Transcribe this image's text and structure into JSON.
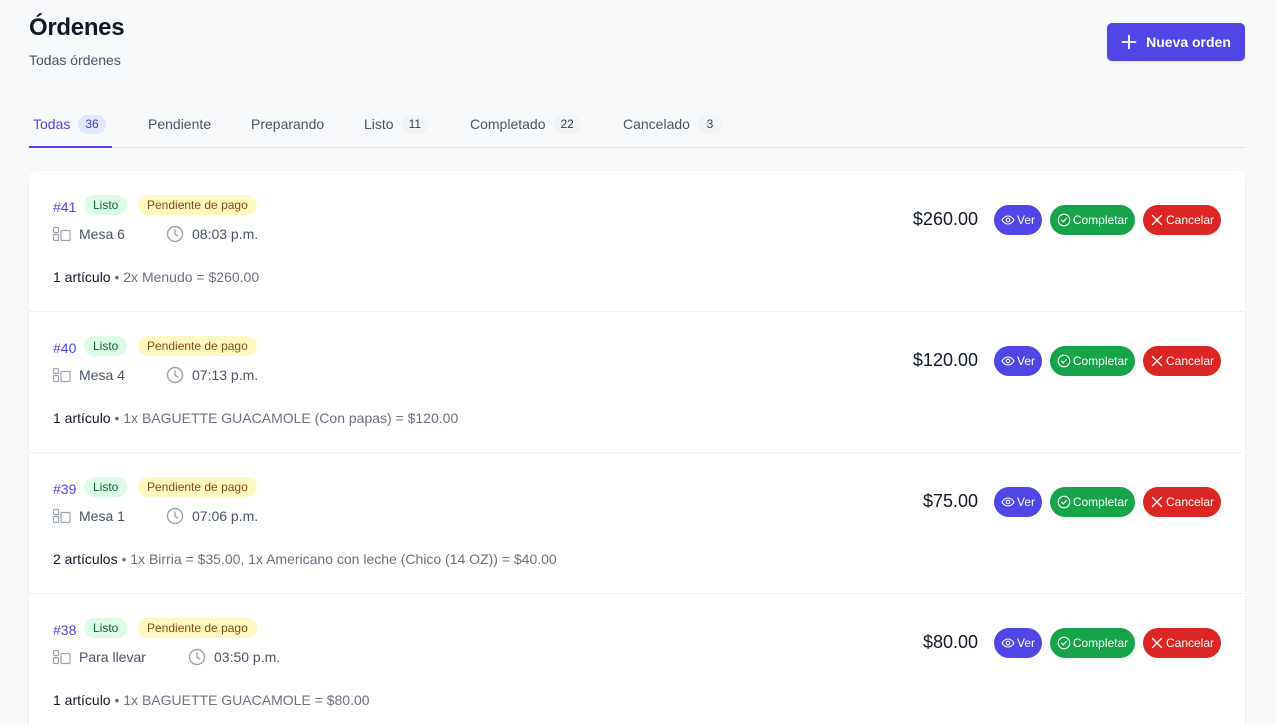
{
  "header": {
    "title": "Órdenes",
    "subtitle": "Todas órdenes",
    "new_order_label": "Nueva orden"
  },
  "tabs": [
    {
      "label": "Todas",
      "count": "36",
      "active": true
    },
    {
      "label": "Pendiente",
      "count": null
    },
    {
      "label": "Preparando",
      "count": null
    },
    {
      "label": "Listo",
      "count": "11"
    },
    {
      "label": "Completado",
      "count": "22"
    },
    {
      "label": "Cancelado",
      "count": "3"
    }
  ],
  "orders": [
    {
      "id": "#41",
      "status": "Listo",
      "payment": "Pendiente de pago",
      "table": "Mesa 6",
      "time": "08:03 p.m.",
      "items_count": "1 artículo",
      "items_detail": " • 2x Menudo = $260.00",
      "total": "$260.00"
    },
    {
      "id": "#40",
      "status": "Listo",
      "payment": "Pendiente de pago",
      "table": "Mesa 4",
      "time": "07:13 p.m.",
      "items_count": "1 artículo",
      "items_detail": " • 1x BAGUETTE GUACAMOLE (Con papas) = $120.00",
      "total": "$120.00"
    },
    {
      "id": "#39",
      "status": "Listo",
      "payment": "Pendiente de pago",
      "table": "Mesa 1",
      "time": "07:06 p.m.",
      "items_count": "2 artículos",
      "items_detail": " • 1x Birria = $35.00, 1x Americano con leche (Chico (14 OZ)) = $40.00",
      "total": "$75.00"
    },
    {
      "id": "#38",
      "status": "Listo",
      "payment": "Pendiente de pago",
      "table": "Para llevar",
      "time": "03:50 p.m.",
      "items_count": "1 artículo",
      "items_detail": " • 1x BAGUETTE GUACAMOLE = $80.00",
      "total": "$80.00"
    }
  ],
  "actions": {
    "view": "Ver",
    "complete": "Completar",
    "cancel": "Cancelar"
  },
  "colors": {
    "primary": "#4f46e5",
    "success": "#16a34a",
    "danger": "#dc2626",
    "ready_badge": "#dcfce7",
    "payment_badge": "#fef9c3"
  }
}
